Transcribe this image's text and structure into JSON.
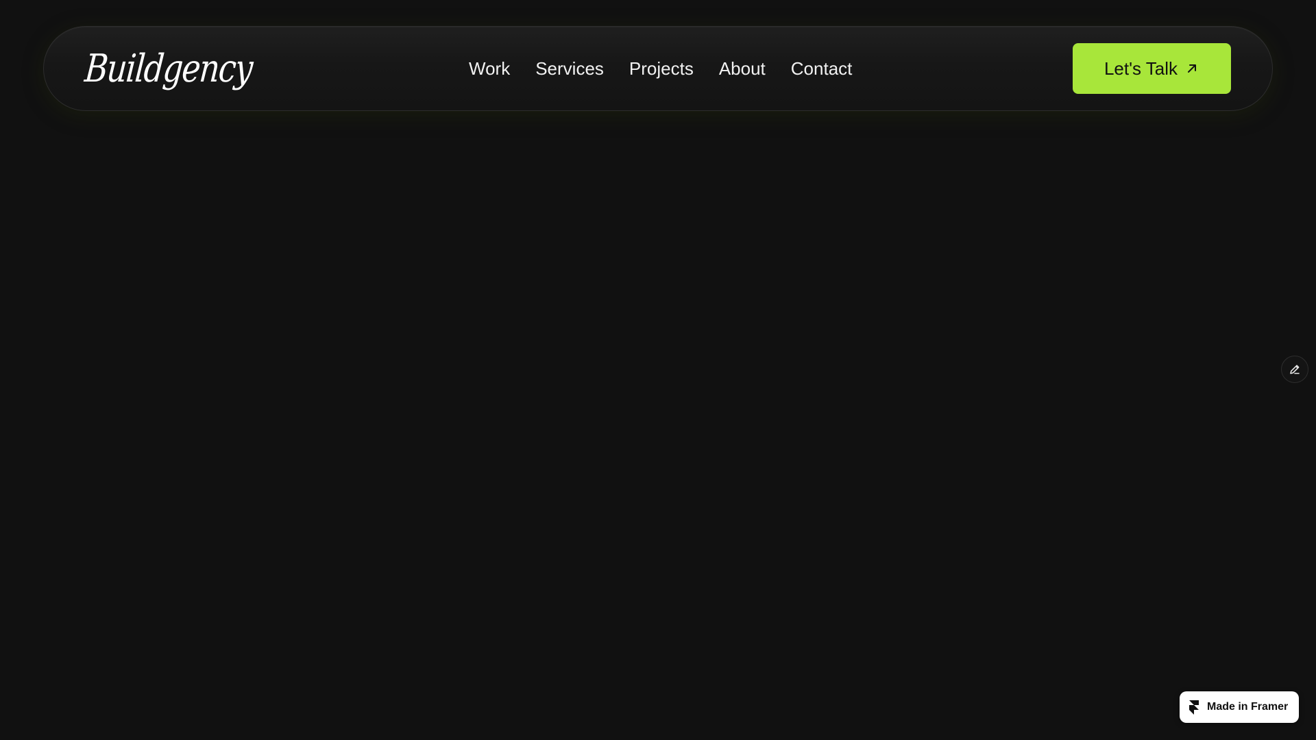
{
  "header": {
    "logo_text": "Buildgency",
    "nav": [
      {
        "label": "Work"
      },
      {
        "label": "Services"
      },
      {
        "label": "Projects"
      },
      {
        "label": "About"
      },
      {
        "label": "Contact"
      }
    ],
    "cta_label": "Let's Talk",
    "cta_icon": "arrow-up-right-icon"
  },
  "floating": {
    "edit_icon": "pencil-icon",
    "badge_label": "Made in Framer",
    "badge_icon": "framer-logo-icon"
  },
  "colors": {
    "background": "#111111",
    "accent": "#a8e63a",
    "nav_text": "#f2f2f2"
  }
}
